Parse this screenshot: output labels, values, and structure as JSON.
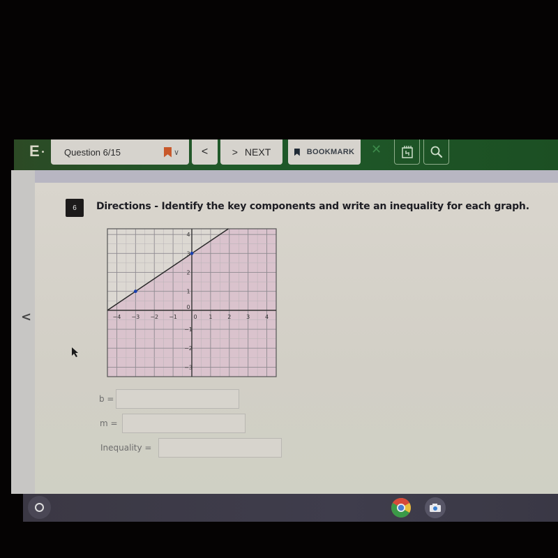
{
  "toolbar": {
    "logo": "E",
    "question_label": "Question 6/15",
    "prev_label": "<",
    "next_arrow": ">",
    "next_label": "NEXT",
    "bookmark_label": "BOOKMARK",
    "close_label": "✕",
    "colors": {
      "bar": "#1f5a2a",
      "button": "#d6d3cd",
      "flag": "#c8582a"
    }
  },
  "question": {
    "number": "6",
    "directions": "Directions - Identify the key components and write an inequality for each graph."
  },
  "sidebar": {
    "prev_arrow": "<"
  },
  "fields": [
    {
      "label": "b =",
      "value": "",
      "placeholder": ""
    },
    {
      "label": "m =",
      "value": "",
      "placeholder": ""
    },
    {
      "label": "Inequality =",
      "value": "",
      "placeholder": ""
    }
  ],
  "taskbar": {
    "apps": [
      "launcher",
      "chrome",
      "camera"
    ]
  },
  "chart_data": {
    "type": "line",
    "title": "",
    "xlabel": "",
    "ylabel": "",
    "xlim": [
      -4.5,
      4.5
    ],
    "ylim": [
      -3.5,
      4.3
    ],
    "x_ticks": [
      -4,
      -3,
      -2,
      -1,
      0,
      1,
      2,
      3,
      4
    ],
    "y_ticks": [
      -3,
      -2,
      -1,
      0,
      1,
      2,
      3,
      4
    ],
    "grid": true,
    "line": {
      "slope": 0.6667,
      "intercept": 3,
      "style": "solid"
    },
    "points": [
      {
        "x": -3,
        "y": 1
      },
      {
        "x": 0,
        "y": 3
      }
    ],
    "shaded_region": "below",
    "shade_color": "#d9bccb",
    "line_color": "#2a2a2a",
    "point_color": "#1a3fb0"
  }
}
